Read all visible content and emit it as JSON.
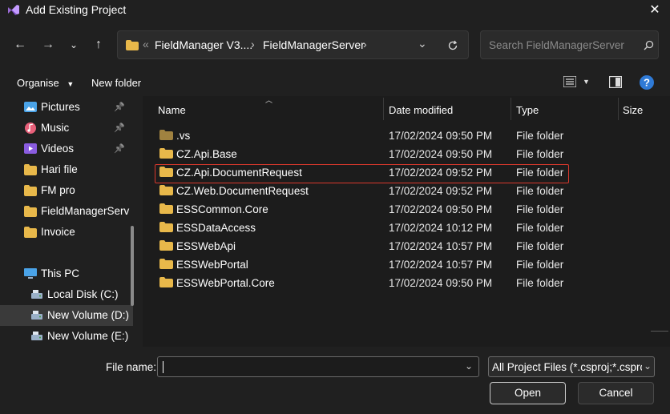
{
  "window": {
    "title": "Add Existing Project"
  },
  "nav": {
    "breadcrumb_overflow": "«",
    "crumbs": [
      "FieldManager V3....",
      "FieldManagerServer"
    ],
    "search_placeholder": "Search FieldManagerServer"
  },
  "toolbar": {
    "organise_label": "Organise",
    "new_folder_label": "New folder"
  },
  "sidebar": {
    "items": [
      {
        "label": "Pictures",
        "icon": "pictures-icon",
        "pinned": true
      },
      {
        "label": "Music",
        "icon": "music-icon",
        "pinned": true
      },
      {
        "label": "Videos",
        "icon": "videos-icon",
        "pinned": true
      },
      {
        "label": "Hari file",
        "icon": "folder-icon",
        "pinned": false
      },
      {
        "label": "FM pro",
        "icon": "folder-icon",
        "pinned": false
      },
      {
        "label": "FieldManagerServ",
        "icon": "folder-icon",
        "pinned": false
      },
      {
        "label": "Invoice",
        "icon": "folder-icon",
        "pinned": false
      },
      {
        "label": "This PC",
        "icon": "pc-icon",
        "pinned": false
      },
      {
        "label": "Local Disk (C:)",
        "icon": "drive-icon",
        "pinned": false
      },
      {
        "label": "New Volume (D:)",
        "icon": "drive-icon",
        "pinned": false,
        "selected": true
      },
      {
        "label": "New Volume (E:)",
        "icon": "drive-icon",
        "pinned": false
      }
    ]
  },
  "columns": {
    "name": "Name",
    "date": "Date modified",
    "type": "Type",
    "size": "Size"
  },
  "files": [
    {
      "name": ".vs",
      "date": "17/02/2024 09:50 PM",
      "type": "File folder"
    },
    {
      "name": "CZ.Api.Base",
      "date": "17/02/2024 09:50 PM",
      "type": "File folder"
    },
    {
      "name": "CZ.Api.DocumentRequest",
      "date": "17/02/2024 09:52 PM",
      "type": "File folder"
    },
    {
      "name": "CZ.Web.DocumentRequest",
      "date": "17/02/2024 09:52 PM",
      "type": "File folder"
    },
    {
      "name": "ESSCommon.Core",
      "date": "17/02/2024 09:50 PM",
      "type": "File folder"
    },
    {
      "name": "ESSDataAccess",
      "date": "17/02/2024 10:12 PM",
      "type": "File folder"
    },
    {
      "name": "ESSWebApi",
      "date": "17/02/2024 10:57 PM",
      "type": "File folder"
    },
    {
      "name": "ESSWebPortal",
      "date": "17/02/2024 10:57 PM",
      "type": "File folder"
    },
    {
      "name": "ESSWebPortal.Core",
      "date": "17/02/2024 09:50 PM",
      "type": "File folder"
    }
  ],
  "footer": {
    "file_name_label": "File name:",
    "file_name_value": "",
    "filter_label": "All Project Files (*.csproj;*.csprc",
    "open_label": "Open",
    "cancel_label": "Cancel"
  },
  "colors": {
    "highlight_border": "#d9382c",
    "folder": "#e8b84a",
    "help": "#2f7ad6"
  }
}
